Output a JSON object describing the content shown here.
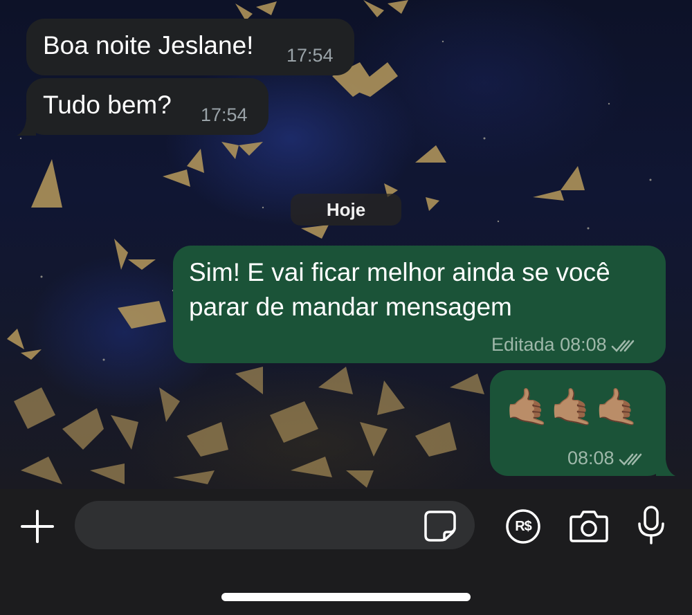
{
  "date_divider": "Hoje",
  "messages": [
    {
      "direction": "in",
      "text": "Boa noite Jeslane!",
      "time": "17:54"
    },
    {
      "direction": "in",
      "text": "Tudo bem?",
      "time": "17:54"
    },
    {
      "direction": "out",
      "lines": [
        "Sim! E vai ficar melhor ainda se você",
        "parar de mandar mensagem"
      ],
      "status": "Editada 08:08",
      "read": true
    },
    {
      "direction": "out",
      "text": "🤙🏽🤙🏽🤙🏽",
      "time": "08:08",
      "read": true
    }
  ],
  "composer": {
    "attach_icon": "plus-icon",
    "sticker_icon": "sticker-icon",
    "pay_label": "R$",
    "camera_icon": "camera-icon",
    "mic_icon": "microphone-icon"
  },
  "colors": {
    "incoming_bubble": "#1f2123",
    "outgoing_bubble": "#1b5338",
    "composer_bg": "#1c1c1e",
    "read_ticks": "#9fb8aa"
  }
}
